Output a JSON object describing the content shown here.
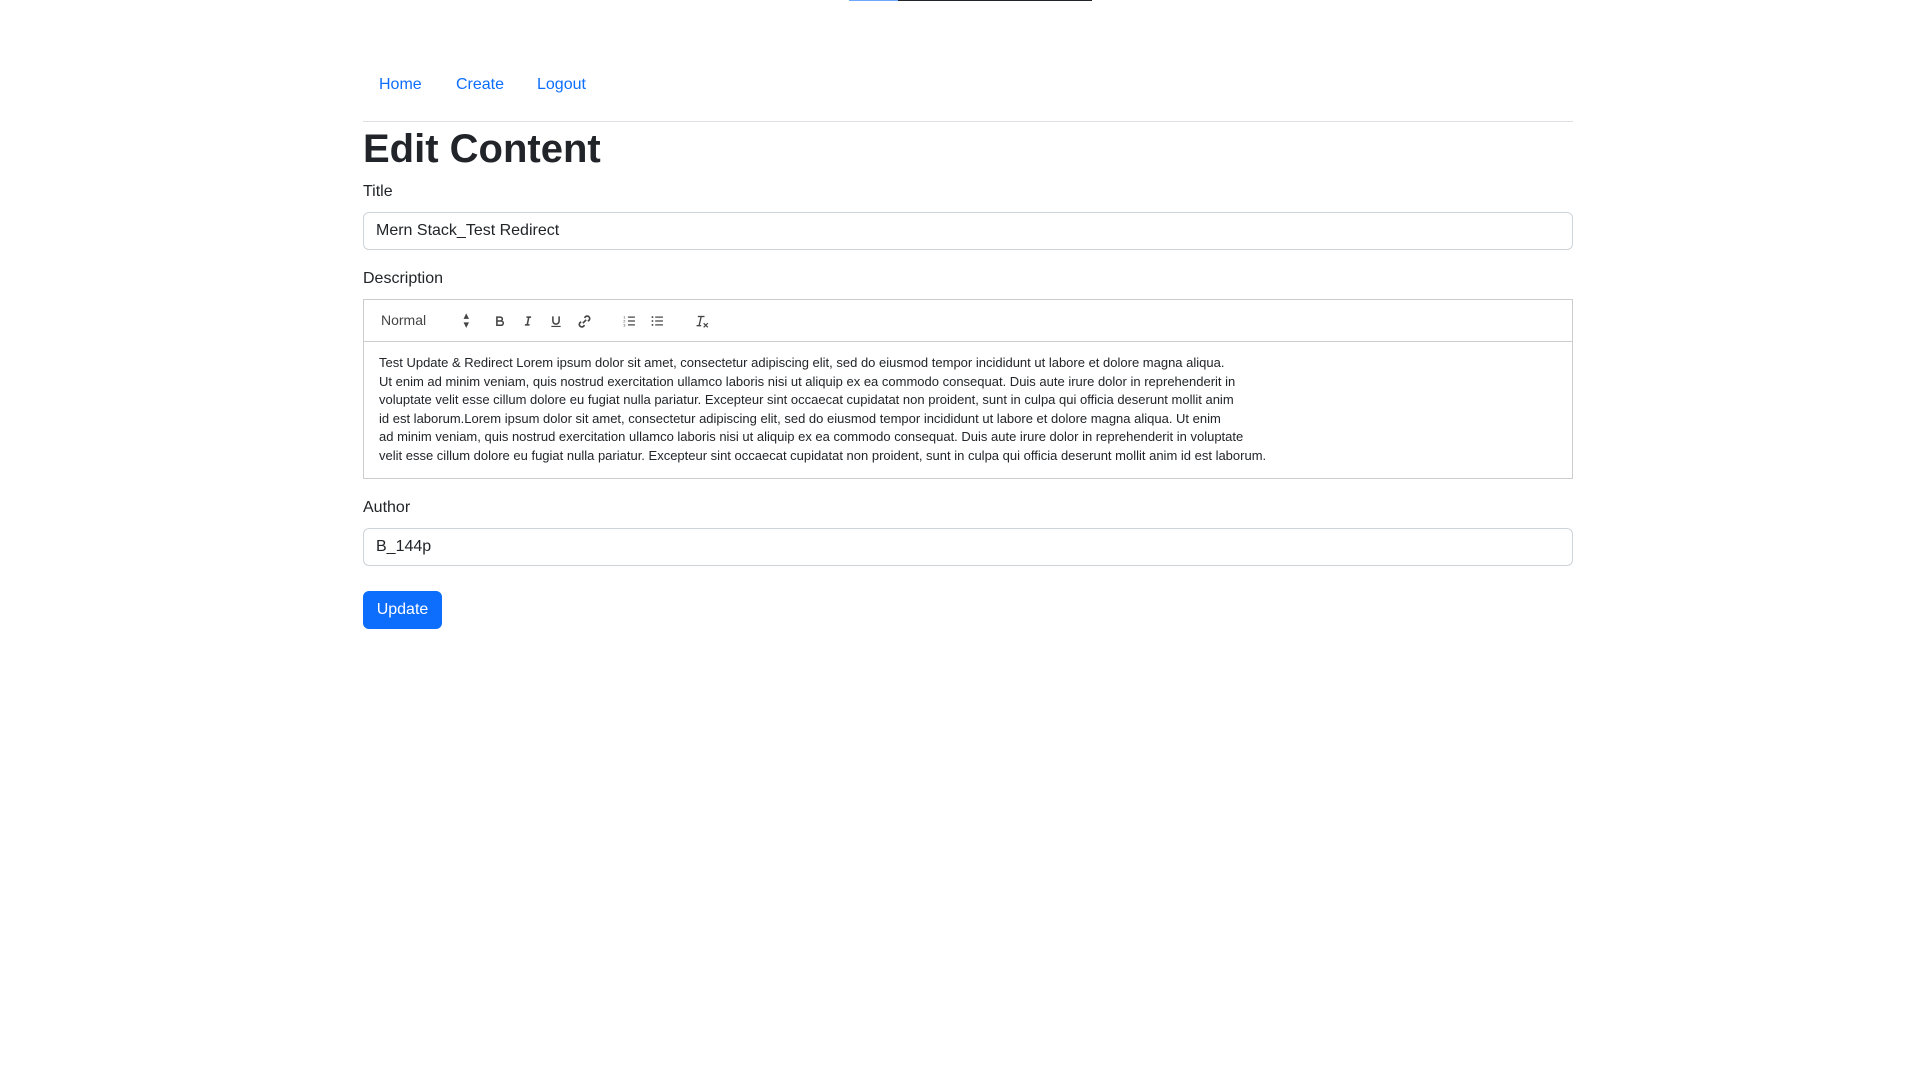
{
  "top_progress": {
    "value": 0.2
  },
  "nav": {
    "items": [
      {
        "label": "Home"
      },
      {
        "label": "Create"
      },
      {
        "label": "Logout"
      }
    ]
  },
  "page_title": "Edit Content",
  "form": {
    "title_label": "Title",
    "title_value": "Mern Stack_Test Redirect",
    "description_label": "Description",
    "author_label": "Author",
    "author_value": "B_144p",
    "submit_label": "Update"
  },
  "editor": {
    "format_select": "Normal",
    "toolbar_icons": [
      "bold-icon",
      "italic-icon",
      "underline-icon",
      "link-icon",
      "ordered-list-icon",
      "bullet-list-icon",
      "clear-format-icon"
    ],
    "lines": [
      "Test Update & Redirect Lorem ipsum dolor sit amet, consectetur adipiscing elit, sed do eiusmod tempor incididunt ut labore et dolore magna aliqua.",
      "Ut enim ad minim veniam, quis nostrud exercitation ullamco laboris nisi ut aliquip ex ea commodo consequat. Duis aute irure dolor in reprehenderit in",
      "voluptate velit esse cillum dolore eu fugiat nulla pariatur. Excepteur sint occaecat cupidatat non proident, sunt in culpa qui officia deserunt mollit anim",
      "id est laborum.Lorem ipsum dolor sit amet, consectetur adipiscing elit, sed do eiusmod tempor incididunt ut labore et dolore magna aliqua. Ut enim",
      "ad minim veniam, quis nostrud exercitation ullamco laboris nisi ut aliquip ex ea commodo consequat. Duis aute irure dolor in reprehenderit in voluptate",
      "velit esse cillum dolore eu fugiat nulla pariatur. Excepteur sint occaecat cupidatat non proident, sunt in culpa qui officia deserunt mollit anim id est laborum."
    ]
  },
  "colors": {
    "link": "#0d6efd",
    "primary": "#0d6efd",
    "text": "#212529",
    "border": "#ced4da"
  }
}
